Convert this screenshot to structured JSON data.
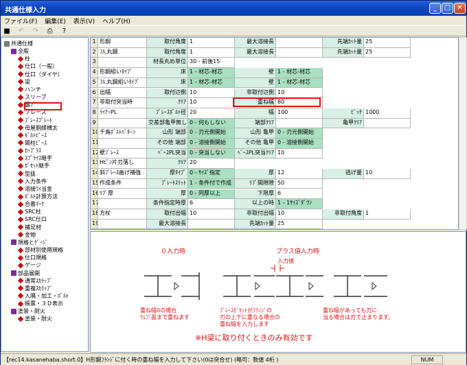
{
  "title": "共通仕様入力",
  "menu": [
    "ファイル(F)",
    "編集(E)",
    "表示(V)",
    "ヘルプ(H)"
  ],
  "toolbar_icons": [
    "save-icon",
    "undo-icon",
    "redo-icon",
    "print-icon",
    "help-icon"
  ],
  "tree": {
    "items": [
      {
        "label": "共通仕様",
        "indent": 0,
        "kind": "folder"
      },
      {
        "label": "全般",
        "indent": 1,
        "kind": "purple"
      },
      {
        "label": "柱",
        "indent": 2,
        "kind": "red"
      },
      {
        "label": "仕口（一般）",
        "indent": 2,
        "kind": "red"
      },
      {
        "label": "仕口（ダイヤ）",
        "indent": 2,
        "kind": "red"
      },
      {
        "label": "梁",
        "indent": 2,
        "kind": "red"
      },
      {
        "label": "ハンチ",
        "indent": 2,
        "kind": "red"
      },
      {
        "label": "スリーブ",
        "indent": 2,
        "kind": "red"
      },
      {
        "label": "露ﾌﾞ",
        "indent": 2,
        "kind": "red"
      },
      {
        "label": "ブレース",
        "indent": 2,
        "kind": "red"
      },
      {
        "label": "ﾌﾞﾚｰｽﾌﾟﾚｰﾄ",
        "indent": 2,
        "kind": "red"
      },
      {
        "label": "母屋胴縁横太",
        "indent": 2,
        "kind": "red"
      },
      {
        "label": "ｷﾞﾙﾄﾋﾟｰｽ",
        "indent": 2,
        "kind": "red"
      },
      {
        "label": "間柱ﾋﾟｰｽ",
        "indent": 2,
        "kind": "red"
      },
      {
        "label": "ｶｯﾌﾟﾗｽ",
        "indent": 2,
        "kind": "red"
      },
      {
        "label": "ｽﾌﾟﾗｲｽ継手",
        "indent": 2,
        "kind": "red"
      },
      {
        "label": "ｶﾞｾｯﾄ継手",
        "indent": 2,
        "kind": "red"
      },
      {
        "label": "型抜",
        "indent": 2,
        "kind": "red"
      },
      {
        "label": "入力条件",
        "indent": 2,
        "kind": "red"
      },
      {
        "label": "溶接ﾜｲ当金",
        "indent": 2,
        "kind": "red"
      },
      {
        "label": "ﾎﾞﾙﾄ計算方法",
        "indent": 2,
        "kind": "red"
      },
      {
        "label": "合番ﾏｰｸ",
        "indent": 2,
        "kind": "red"
      },
      {
        "label": "SRC柱",
        "indent": 2,
        "kind": "red"
      },
      {
        "label": "SRC仕口",
        "indent": 2,
        "kind": "red"
      },
      {
        "label": "補足材",
        "indent": 2,
        "kind": "red"
      },
      {
        "label": "金物",
        "indent": 2,
        "kind": "red"
      },
      {
        "label": "規格とｹﾞｰｼﾞ",
        "indent": 1,
        "kind": "purple"
      },
      {
        "label": "部材別使用規格",
        "indent": 2,
        "kind": "red"
      },
      {
        "label": "仕口規格",
        "indent": 2,
        "kind": "red"
      },
      {
        "label": "ゲージ",
        "indent": 2,
        "kind": "red"
      },
      {
        "label": "部品展開",
        "indent": 1,
        "kind": "purple"
      },
      {
        "label": "通常ｽｶﾗｯﾌﾟ",
        "indent": 2,
        "kind": "red"
      },
      {
        "label": "重複ｽｶﾗｯﾌﾟ",
        "indent": 2,
        "kind": "red"
      },
      {
        "label": "入隅・加工・ﾎﾞﾙﾄ",
        "indent": 2,
        "kind": "red"
      },
      {
        "label": "帳票・３Ｄ表示",
        "indent": 2,
        "kind": "red"
      },
      {
        "label": "塗装・耐火",
        "indent": 1,
        "kind": "purple"
      },
      {
        "label": "塗装・耐火",
        "indent": 2,
        "kind": "red"
      }
    ]
  },
  "grid": {
    "rows": [
      {
        "n": "1",
        "label": "形鋼",
        "cells": [
          [
            "取付角度",
            "1"
          ],
          [
            "最大溶接長",
            ""
          ],
          [
            "先端ｶｯﾄ量",
            "25"
          ],
          [
            "非取付角度",
            "1"
          ]
        ]
      },
      {
        "n": "2",
        "label": "ﾌﾙ,丸鋼",
        "cells": [
          [
            "取付角度",
            "1"
          ],
          [
            "最大溶接長",
            ""
          ],
          [
            "先端ｶｯﾄ量",
            "25"
          ],
          [
            "非取付角度",
            "1"
          ]
        ]
      },
      {
        "n": "3",
        "label": "",
        "cells": [
          [
            "材長丸め単位",
            "30 - 前後15"
          ]
        ]
      },
      {
        "n": "4",
        "label": "形鋼組いﾀｲﾌﾟ",
        "cells": [
          [
            "床",
            "1 - 材芯-材芯"
          ],
          [
            "壁",
            "1 - 材芯-材芯"
          ]
        ]
      },
      {
        "n": "5",
        "label": "ﾌﾙ,丸鋼組いﾀｲﾌﾟ",
        "cells": [
          [
            "床",
            "1 - 材芯-材芯"
          ],
          [
            "壁",
            "1 - 材芯-材芯"
          ]
        ]
      },
      {
        "n": "6",
        "label": "出幅",
        "cells": [
          [
            "取付辺側",
            "10"
          ],
          [
            "非取付辺側",
            "10"
          ]
        ]
      },
      {
        "n": "7",
        "label": "非取付突当時",
        "cells": [
          [
            "ｸﾘｱ",
            "10"
          ],
          [
            "重ね幅",
            "80"
          ]
        ]
      },
      {
        "n": "8",
        "label": "ﾗｲﾅｰPL",
        "cells": [
          [
            "ﾌﾞﾚｰｽﾎﾞﾙﾄ径",
            "20"
          ],
          [
            "幅",
            "100"
          ],
          [
            "ﾋﾟｯﾁ",
            "1000"
          ]
        ]
      },
      {
        "n": "9",
        "label": "",
        "cells": [
          [
            "交差部亀甲無し",
            "0 - 何もしない"
          ],
          [
            "端部ｸﾘｱ",
            ""
          ],
          [
            "亀甲ｸﾘｱ",
            ""
          ]
        ]
      },
      {
        "n": "10",
        "label": "千鳥ﾎﾞﾙﾄﾊﾟﾀｰﾝ",
        "cells": [
          [
            "山形 端部",
            "0 - 刃元側開始"
          ],
          [
            "山形 亀甲",
            "0 - 刃元側開始"
          ]
        ]
      },
      {
        "n": "11",
        "label": "",
        "cells": [
          [
            "その他 端部",
            "0 - 溶接側開始"
          ],
          [
            "その他 亀甲",
            "0 - 溶接側開始"
          ]
        ]
      },
      {
        "n": "12",
        "label": "壁ﾌﾞﾚｰｽ",
        "cells": [
          [
            "ﾍﾞｰｽPL突当",
            "0 - 突当しない"
          ],
          [
            "ﾍﾞｰｽPL突当ｸﾘｱ",
            "10"
          ]
        ]
      },
      {
        "n": "13",
        "label": "Hﾋﾟﾝ片刃落し",
        "cells": [
          [
            "ｸﾘｱ",
            "20"
          ]
        ]
      },
      {
        "n": "14",
        "label": "斜ﾌﾞﾚｰｽ曲げ補強",
        "cells": [
          [
            "厚ﾀｲﾌﾟ",
            "0 - ｻｲｽﾞ指定"
          ],
          [
            "厚",
            "12"
          ],
          [
            "逃げ量",
            "10"
          ]
        ]
      },
      {
        "n": "15",
        "label": "作成条件",
        "cells": [
          [
            "ﾌﾟﾚｰﾄｽﾘｯﾄ",
            "1 - 条件付で作成"
          ],
          [
            "ﾘﾌﾞ間隙隙",
            "50"
          ]
        ]
      },
      {
        "n": "16",
        "label": "ﾘﾌﾞ厚",
        "cells": [
          [
            "厚",
            "0 - 同厚以上"
          ],
          [
            "下限厚",
            "6"
          ]
        ]
      },
      {
        "n": "17",
        "label": "",
        "cells": [
          [
            "条件指定時厚",
            "6"
          ],
          [
            "以上の時",
            "1 - 1ｻｲｽﾞﾀﾞｳﾝ"
          ]
        ]
      },
      {
        "n": "18",
        "label": "方杖",
        "cells": [
          [
            "取付出幅",
            "10"
          ],
          [
            "非取付出幅",
            "10"
          ],
          [
            "非取付角度",
            "1"
          ],
          [
            "取付タイプ",
            "1 - 柱梁垂直"
          ]
        ]
      },
      {
        "n": "19",
        "label": "",
        "cells": [
          [
            "最大溶接長",
            ""
          ],
          [
            "先端ｶｯﾄ量",
            "25"
          ]
        ]
      }
    ]
  },
  "diagram": {
    "label_zero": "０入力時",
    "label_plus": "プラス値入力時",
    "label_input": "入力値",
    "note1_a": "重ね幅0の場合",
    "note1_b": "ｳｪﾌﾞ面まで重ねます",
    "note2_a": "ﾌﾞﾚｰｽｶﾞｾｯﾄがﾌﾗﾝｼﾞの",
    "note2_b": "刃の上下に重なる場合の",
    "note2_c": "重ね幅を入力します",
    "note3_a": "重ね幅があっても刃に",
    "note3_b": "当る場合は刃で止まります。",
    "footer": "※H梁に取り付くときのみ有効です"
  },
  "status": {
    "text": "【rec14.kasanehaba.short.0】H形鋼ﾌﾗﾝｼﾞに付く時の重ね幅を入力して下さい(0は突合せ) (略可：数値 4桁 )",
    "num": "NUM"
  }
}
